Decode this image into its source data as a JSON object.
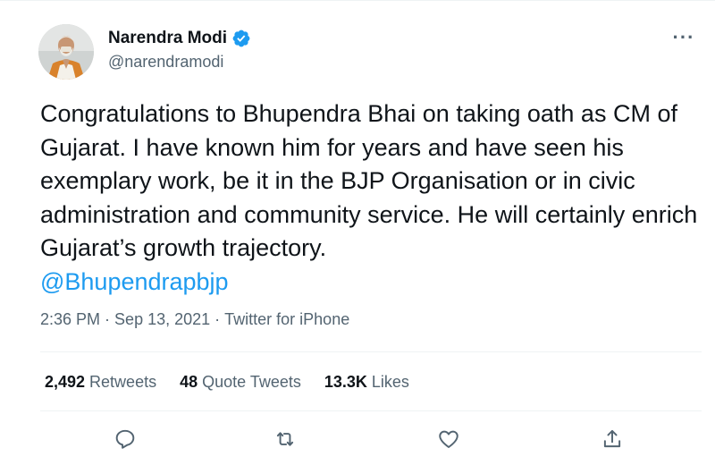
{
  "author": {
    "name": "Narendra Modi",
    "handle": "@narendramodi",
    "verified": true
  },
  "tweet": {
    "text": "Congratulations to Bhupendra Bhai on taking oath as CM of Gujarat. I have known him for years and have seen his exemplary work, be it in the BJP Organisation or in civic administration and community service. He will certainly enrich Gujarat’s growth trajectory.",
    "mention": "@Bhupendrapbjp"
  },
  "meta": {
    "time": "2:36 PM",
    "date": "Sep 13, 2021",
    "source": "Twitter for iPhone",
    "separator": "·"
  },
  "stats": {
    "retweets_count": "2,492",
    "retweets_label": "Retweets",
    "quotes_count": "48",
    "quotes_label": "Quote Tweets",
    "likes_count": "13.3K",
    "likes_label": "Likes"
  },
  "more_menu": {
    "label": "···"
  },
  "colors": {
    "accent": "#1d9bf0",
    "text": "#0f1419",
    "secondary": "#536471",
    "divider": "#eff3f4"
  },
  "icons": {
    "reply": "reply-icon",
    "retweet": "retweet-icon",
    "like": "heart-icon",
    "share": "share-icon",
    "verified": "verified-badge-icon"
  }
}
